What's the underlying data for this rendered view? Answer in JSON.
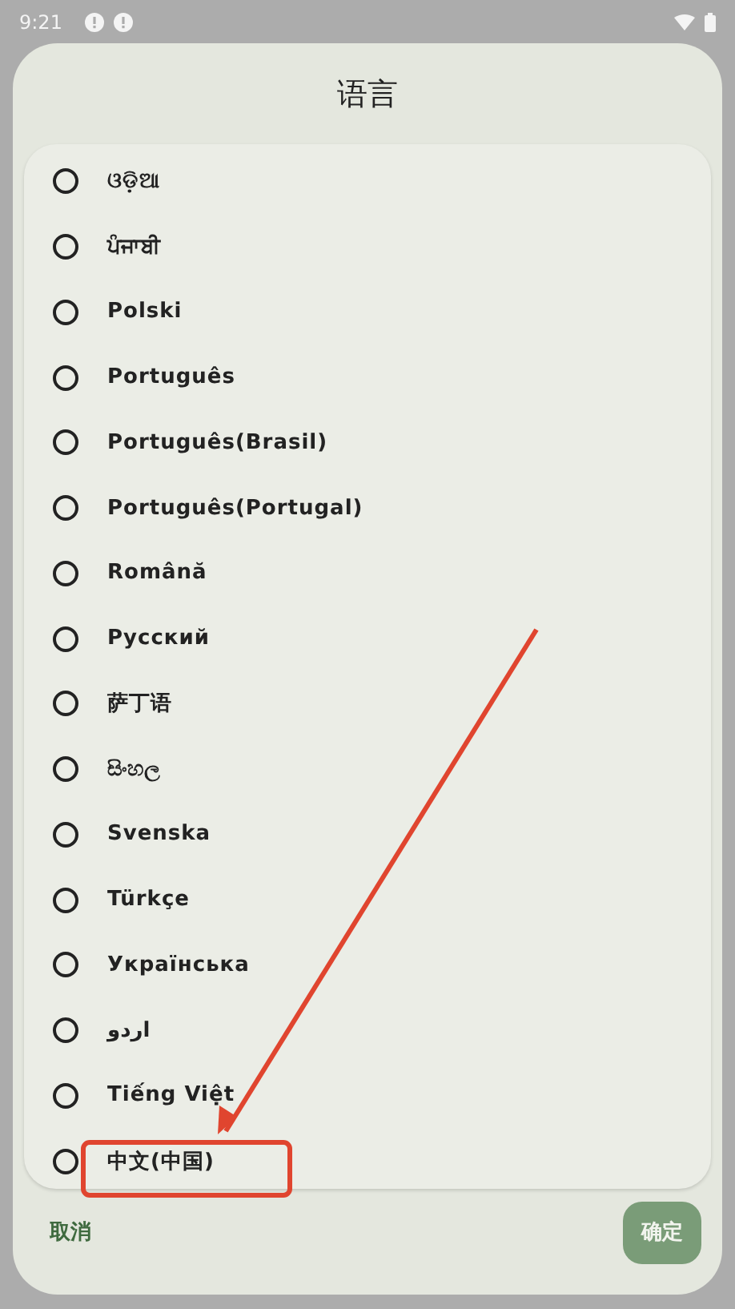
{
  "status_bar": {
    "time": "9:21"
  },
  "dialog": {
    "title": "语言",
    "options": [
      {
        "label": "ଓଡ଼ିଆ",
        "selected": false
      },
      {
        "label": "ਪੰਜਾਬੀ",
        "selected": false
      },
      {
        "label": "Polski",
        "selected": false
      },
      {
        "label": "Português",
        "selected": false
      },
      {
        "label": "Português(Brasil)",
        "selected": false
      },
      {
        "label": "Português(Portugal)",
        "selected": false
      },
      {
        "label": "Română",
        "selected": false
      },
      {
        "label": "Русский",
        "selected": false
      },
      {
        "label": "萨丁语",
        "selected": false
      },
      {
        "label": "සිංහල",
        "selected": false
      },
      {
        "label": "Svenska",
        "selected": false
      },
      {
        "label": "Türkçe",
        "selected": false
      },
      {
        "label": "Українська",
        "selected": false
      },
      {
        "label": "اردو",
        "selected": false
      },
      {
        "label": "Tiếng Việt",
        "selected": false
      },
      {
        "label": "中文(中国)",
        "selected": false
      }
    ],
    "buttons": [
      {
        "kind": "text",
        "label": "取消"
      },
      {
        "kind": "filled",
        "label": "确定"
      }
    ]
  }
}
